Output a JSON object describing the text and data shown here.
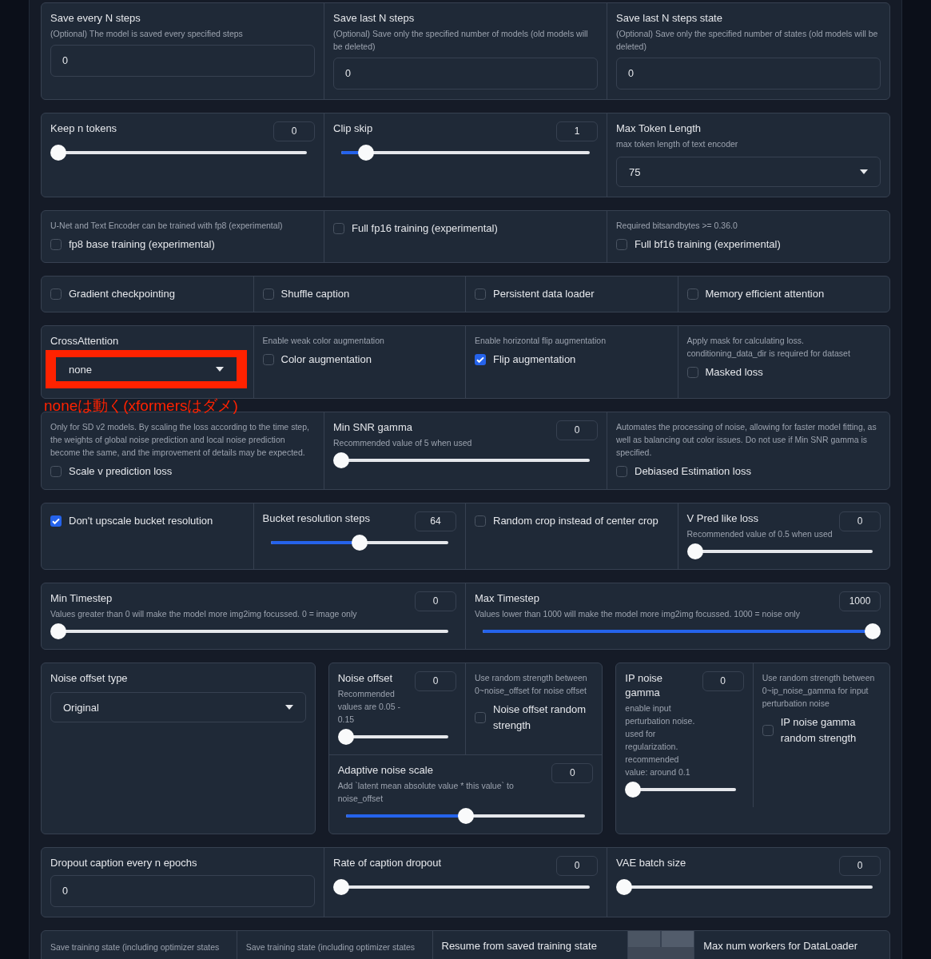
{
  "rows": [
    {
      "blocks": [
        {
          "lines": [
            [
              {
                "kind": "number",
                "label": "Save every N steps",
                "info": "(Optional) The model is saved every specified steps",
                "value": "0"
              },
              {
                "kind": "number",
                "label": "Save last N steps",
                "info": "(Optional) Save only the specified number of models (old models will be deleted)",
                "value": "0"
              },
              {
                "kind": "number",
                "label": "Save last N steps state",
                "info": "(Optional) Save only the specified number of states (old models will be deleted)",
                "value": "0"
              }
            ]
          ]
        }
      ]
    },
    {
      "blocks": [
        {
          "lines": [
            [
              {
                "kind": "slider",
                "label": "Keep n tokens",
                "value": "0",
                "level": 0
              },
              {
                "kind": "slider",
                "label": "Clip skip",
                "value": "1",
                "level": 0.1
              },
              {
                "kind": "dropdown",
                "label": "Max Token Length",
                "info": "max token length of text encoder",
                "value": "75",
                "highlighted": false
              }
            ]
          ]
        }
      ]
    },
    {
      "blocks": [
        {
          "lines": [
            [
              {
                "kind": "checkbox",
                "info": "U-Net and Text Encoder can be trained with fp8 (experimental)",
                "label": "fp8 base training (experimental)",
                "checked": false
              },
              {
                "kind": "checkbox",
                "label": "Full fp16 training (experimental)",
                "checked": false
              },
              {
                "kind": "checkbox",
                "info": "Required bitsandbytes >= 0.36.0",
                "label": "Full bf16 training (experimental)",
                "checked": false
              }
            ]
          ]
        }
      ]
    },
    {
      "blocks": [
        {
          "lines": [
            [
              {
                "kind": "checkbox",
                "label": "Gradient checkpointing",
                "checked": false
              },
              {
                "kind": "checkbox",
                "label": "Shuffle caption",
                "checked": false
              },
              {
                "kind": "checkbox",
                "label": "Persistent data loader",
                "checked": false
              },
              {
                "kind": "checkbox",
                "label": "Memory efficient attention",
                "checked": false
              }
            ]
          ]
        }
      ]
    },
    {
      "blocks": [
        {
          "lines": [
            [
              {
                "kind": "dropdown",
                "label": "CrossAttention",
                "value": "none",
                "highlighted": true,
                "annotation": "noneは動く(xformersはダメ)"
              },
              {
                "kind": "checkbox",
                "info": "Enable weak color augmentation",
                "label": "Color augmentation",
                "checked": false
              },
              {
                "kind": "checkbox",
                "info": "Enable horizontal flip augmentation",
                "label": "Flip augmentation",
                "checked": true
              },
              {
                "kind": "checkbox",
                "info": "Apply mask for calculating loss. conditioning_data_dir is required for dataset",
                "label": "Masked loss",
                "checked": false
              }
            ]
          ]
        }
      ]
    },
    {
      "blocks": [
        {
          "lines": [
            [
              {
                "kind": "checkbox",
                "info": "Only for SD v2 models. By scaling the loss according to the time step, the weights of global noise prediction and local noise prediction become the same, and the improvement of details may be expected.",
                "label": "Scale v prediction loss",
                "checked": false
              },
              {
                "kind": "slider",
                "label": "Min SNR gamma",
                "info": "Recommended value of 5 when used",
                "value": "0",
                "level": 0
              },
              {
                "kind": "checkbox",
                "info": "Automates the processing of noise, allowing for faster model fitting, as well as balancing out color issues. Do not use if Min SNR gamma is specified.",
                "label": "Debiased Estimation loss",
                "checked": false
              }
            ]
          ]
        }
      ]
    },
    {
      "blocks": [
        {
          "lines": [
            [
              {
                "kind": "checkbox",
                "label": "Don't upscale bucket resolution",
                "checked": true
              },
              {
                "kind": "slider",
                "label": "Bucket resolution steps",
                "value": "64",
                "level": 0.5
              },
              {
                "kind": "checkbox",
                "label": "Random crop instead of center crop",
                "checked": false
              },
              {
                "kind": "slider",
                "label": "V Pred like loss",
                "info": "Recommended value of 0.5 when used",
                "value": "0",
                "level": 0
              }
            ]
          ]
        }
      ]
    },
    {
      "blocks": [
        {
          "lines": [
            [
              {
                "kind": "slider",
                "label": "Min Timestep",
                "info": "Values greater than 0 will make the model more img2img focussed. 0 = image only",
                "value": "0",
                "level": 0
              },
              {
                "kind": "slider",
                "label": "Max Timestep",
                "info": "Values lower than 1000 will make the model more img2img focussed. 1000 = noise only",
                "value": "1000",
                "level": 1
              }
            ]
          ]
        }
      ]
    },
    {
      "blocks": [
        {
          "lines": [
            [
              {
                "kind": "dropdown",
                "label": "Noise offset type",
                "value": "Original",
                "highlighted": false
              }
            ]
          ]
        },
        {
          "lines": [
            [
              {
                "kind": "slider",
                "label": "Noise offset",
                "info": "Recommended values are 0.05 - 0.15",
                "value": "0",
                "level": 0
              },
              {
                "kind": "checkbox",
                "info": "Use random strength between 0~noise_offset for noise offset",
                "label": "Noise offset random strength",
                "checked": false
              }
            ],
            [
              {
                "kind": "slider",
                "label": "Adaptive noise scale",
                "info": "Add `latent mean absolute value * this value` to noise_offset",
                "value": "0",
                "level": 0.5
              }
            ]
          ]
        },
        {
          "lines": [
            [
              {
                "kind": "slider",
                "label": "IP noise gamma",
                "info": "enable input perturbation noise. used for regularization. recommended value: around 0.1",
                "value": "0",
                "level": 0
              },
              {
                "kind": "checkbox",
                "info": "Use random strength between 0~ip_noise_gamma for input perturbation noise",
                "label": "IP noise gamma random strength",
                "checked": false
              }
            ]
          ]
        }
      ]
    },
    {
      "blocks": [
        {
          "lines": [
            [
              {
                "kind": "number",
                "label": "Dropout caption every n epochs",
                "value": "0"
              },
              {
                "kind": "slider",
                "label": "Rate of caption dropout",
                "value": "0",
                "level": 0
              },
              {
                "kind": "slider",
                "label": "VAE batch size",
                "value": "0",
                "level": 0
              }
            ]
          ]
        }
      ]
    },
    {
      "blocks": [
        {
          "lines": [
            [
              {
                "kind": "note",
                "info": "Save training state (including optimizer states"
              },
              {
                "kind": "note",
                "info": "Save training state (including optimizer states"
              },
              {
                "kind": "note",
                "label": "Resume from saved training state"
              },
              {
                "kind": "picture"
              },
              {
                "kind": "note",
                "label": "Max num workers for DataLoader"
              }
            ]
          ]
        }
      ]
    }
  ]
}
